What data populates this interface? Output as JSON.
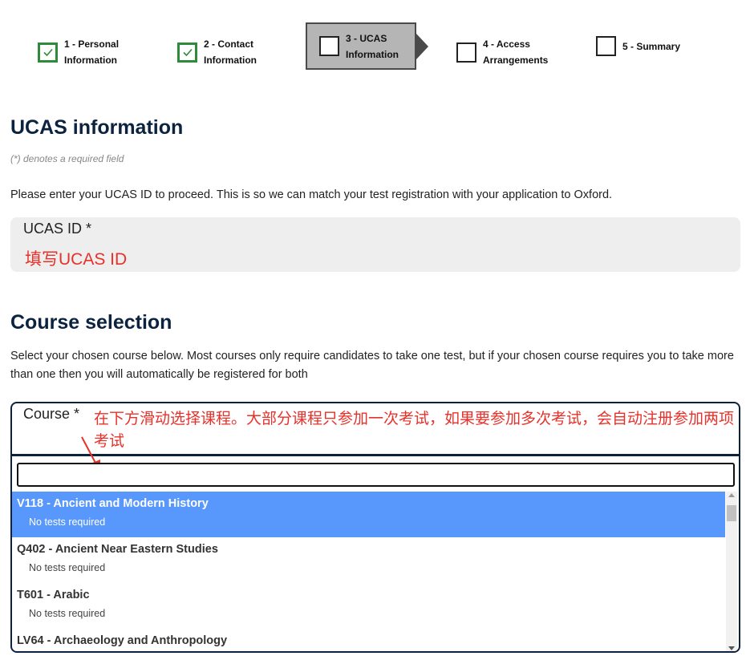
{
  "stepper": [
    {
      "label": "1 - Personal\nInformation",
      "state": "done"
    },
    {
      "label": "2 - Contact\nInformation",
      "state": "done"
    },
    {
      "label": "3 - UCAS\nInformation",
      "state": "active"
    },
    {
      "label": "4 - Access\nArrangements",
      "state": "todo"
    },
    {
      "label": "5 - Summary",
      "state": "todo"
    }
  ],
  "ucas": {
    "heading": "UCAS information",
    "required_note": "(*) denotes a required field",
    "instructions": "Please enter your UCAS ID to proceed. This is so we can match your test registration with your application to Oxford.",
    "field_label": "UCAS ID *",
    "annotation": "填写UCAS ID"
  },
  "course": {
    "heading": "Course selection",
    "instructions": "Select your chosen course below. Most courses only require candidates to take one test, but if your chosen course requires you to take more than one then you will automatically be registered for both",
    "field_label": "Course *",
    "annotation": "在下方滑动选择课程。大部分课程只参加一次考试，如果要参加多次考试，会自动注册参加两项考试",
    "search_value": "",
    "options": [
      {
        "title": "V118 - Ancient and Modern History",
        "subtitle": "No tests required",
        "selected": true
      },
      {
        "title": "Q402 - Ancient Near Eastern Studies",
        "subtitle": "No tests required",
        "selected": false
      },
      {
        "title": "T601 - Arabic",
        "subtitle": "No tests required",
        "selected": false
      },
      {
        "title": "LV64 - Archaeology and Anthropology",
        "subtitle": "",
        "selected": false
      }
    ]
  },
  "colors": {
    "heading": "#0c2340",
    "done_check": "#2e8b3a",
    "active_step_bg": "#b5b5b5",
    "annotation_red": "#e8312a",
    "selected_option": "#5897fb"
  },
  "icons": {
    "done": "checkmark-icon",
    "todo": "empty-checkbox-icon"
  }
}
